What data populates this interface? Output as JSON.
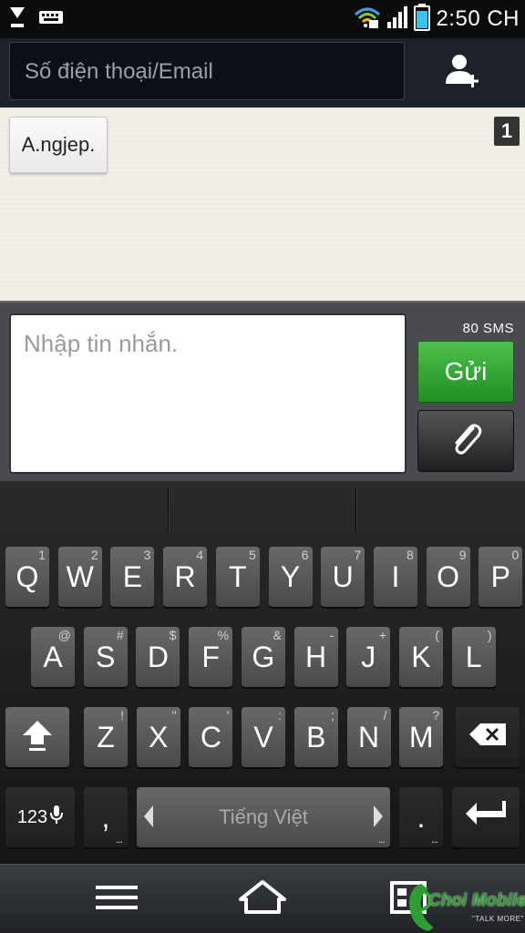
{
  "status_bar": {
    "time": "2:50 CH",
    "icons": [
      "download-icon",
      "keyboard-icon",
      "wifi-icon",
      "signal-icon",
      "battery-icon"
    ]
  },
  "recipient": {
    "placeholder": "Số  điện thoại/Email",
    "add_contact_icon": "add-contact-icon"
  },
  "conversation": {
    "chip_label": "A.ngjep.",
    "count": "1"
  },
  "compose": {
    "placeholder": "Nhập tin nhắn.",
    "sms_count": "80  SMS",
    "send_label": "Gửi",
    "attach_icon": "paperclip-icon"
  },
  "keyboard": {
    "row1": [
      {
        "k": "Q",
        "s": "1"
      },
      {
        "k": "W",
        "s": "2"
      },
      {
        "k": "E",
        "s": "3"
      },
      {
        "k": "R",
        "s": "4"
      },
      {
        "k": "T",
        "s": "5"
      },
      {
        "k": "Y",
        "s": "6"
      },
      {
        "k": "U",
        "s": "7"
      },
      {
        "k": "I",
        "s": "8"
      },
      {
        "k": "O",
        "s": "9"
      },
      {
        "k": "P",
        "s": "0"
      }
    ],
    "row2": [
      {
        "k": "A",
        "s": "@"
      },
      {
        "k": "S",
        "s": "#"
      },
      {
        "k": "D",
        "s": "$"
      },
      {
        "k": "F",
        "s": "%"
      },
      {
        "k": "G",
        "s": "&"
      },
      {
        "k": "H",
        "s": "-"
      },
      {
        "k": "J",
        "s": "+"
      },
      {
        "k": "K",
        "s": "("
      },
      {
        "k": "L",
        "s": ")"
      }
    ],
    "row3": [
      {
        "k": "Z",
        "s": "!"
      },
      {
        "k": "X",
        "s": "\""
      },
      {
        "k": "C",
        "s": "'"
      },
      {
        "k": "V",
        "s": ":"
      },
      {
        "k": "B",
        "s": ";"
      },
      {
        "k": "N",
        "s": "/"
      },
      {
        "k": "M",
        "s": "?"
      }
    ],
    "symbols_label": "123",
    "comma": ",",
    "space_label": "Tiếng Việt",
    "period": ".",
    "more": "...",
    "accent_color": "#2e9e33"
  },
  "navbar": {
    "icons": [
      "menu-icon",
      "home-icon",
      "dual-window-icon"
    ]
  },
  "watermark": {
    "brand": "Choi Mobile",
    "tagline": "\"TALK MORE\""
  }
}
